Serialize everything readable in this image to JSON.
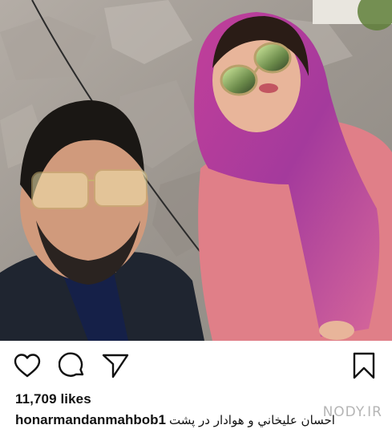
{
  "post": {
    "photo": {
      "alt_subject": "selfie-photo"
    },
    "actions": {
      "like_icon": "heart-icon",
      "comment_icon": "comment-bubble-icon",
      "share_icon": "paper-plane-icon",
      "save_icon": "bookmark-icon"
    },
    "likes_text": "11,709 likes",
    "caption": {
      "username": "honarmandanmahbob1",
      "text": "احسان عليخاني و هوادار در پشت"
    },
    "watermark": "NODY.IR"
  },
  "colors": {
    "icon_stroke": "#111111",
    "background": "#ffffff",
    "text": "#111111"
  }
}
